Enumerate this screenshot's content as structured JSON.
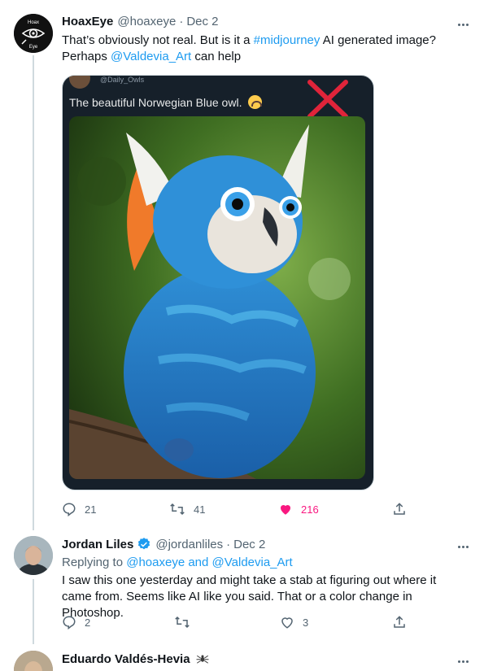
{
  "tweets": [
    {
      "display_name": "HoaxEye",
      "handle": "@hoaxeye",
      "date": "Dec 2",
      "avatar_text_top": "Hoax",
      "avatar_text_bottom": "Eye",
      "text_part1": "That’s obviously not real. But is it a ",
      "hashtag": "#midjourney",
      "text_part2": " AI generated image?",
      "text_line2_prefix": "Perhaps ",
      "mention": "@Valdevia_Art",
      "text_line2_suffix": " can help",
      "media": {
        "handle": "@Daily_Owls",
        "caption": "The beautiful Norwegian Blue owl."
      },
      "stats": {
        "replies": "21",
        "retweets": "41",
        "likes": "216"
      }
    },
    {
      "display_name": "Jordan Liles",
      "handle": "@jordanliles",
      "date": "Dec 2",
      "replying_to_prefix": "Replying to ",
      "replying_to": "@hoaxeye and @Valdevia_Art",
      "text": "I saw this one yesterday and might take a stab at figuring out where it came from. Seems like AI like you said. That or a color change in Photoshop.",
      "stats": {
        "replies": "2",
        "retweets": "",
        "likes": "3"
      }
    },
    {
      "display_name": "Eduardo Valdés-Hevia"
    }
  ],
  "colors": {
    "accent": "#1d9bf0",
    "like": "#f91880",
    "muted": "#536471",
    "verified": "#1d9bf0"
  }
}
